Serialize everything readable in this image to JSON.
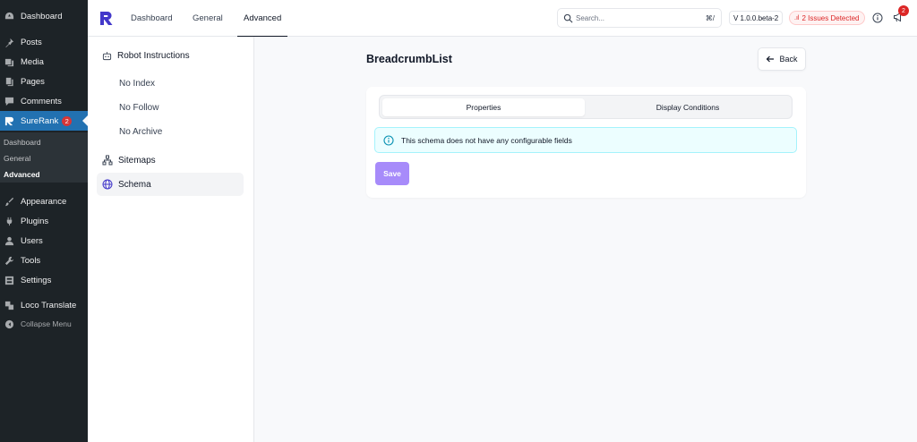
{
  "wp_menu": {
    "dashboard": "Dashboard",
    "posts": "Posts",
    "media": "Media",
    "pages": "Pages",
    "comments": "Comments",
    "surerank": "SureRank",
    "surerank_badge": "2",
    "submenu": [
      "Dashboard",
      "General",
      "Advanced"
    ],
    "appearance": "Appearance",
    "plugins": "Plugins",
    "users": "Users",
    "tools": "Tools",
    "settings": "Settings",
    "loco": "Loco Translate",
    "collapse": "Collapse Menu"
  },
  "topnav": {
    "tabs": [
      "Dashboard",
      "General",
      "Advanced"
    ],
    "active_tab": "Advanced",
    "search_placeholder": "Search...",
    "search_shortcut": "⌘/",
    "version": "V 1.0.0.beta-2",
    "issues": "2 Issues Detected",
    "notifications_count": "2"
  },
  "settings_nav": {
    "robot_group": "Robot Instructions",
    "robot_items": [
      "No Index",
      "No Follow",
      "No Archive"
    ],
    "sitemaps": "Sitemaps",
    "schema": "Schema"
  },
  "main": {
    "title": "BreadcrumbList",
    "back_label": "Back",
    "tabs": [
      "Properties",
      "Display Conditions"
    ],
    "active_tab": "Properties",
    "notice": "This schema does not have any configurable fields",
    "save_label": "Save"
  },
  "colors": {
    "wp_sidebar": "#1d2327",
    "wp_active": "#2271b1",
    "accent": "#a78bfa",
    "danger": "#dc2626",
    "notice_bg": "#ecfeff"
  },
  "icons": {
    "wp": [
      "dashboard-icon",
      "pin-icon",
      "media-icon",
      "pages-icon",
      "comment-icon",
      "surerank-icon",
      "brush-icon",
      "plug-icon",
      "user-icon",
      "wrench-icon",
      "settings-icon",
      "translate-icon",
      "collapse-icon"
    ],
    "top": [
      "logo-icon",
      "search-icon",
      "info-icon",
      "megaphone-icon"
    ],
    "nav": [
      "robot-icon",
      "sitemap-icon",
      "globe-icon"
    ],
    "main": [
      "arrow-left-icon",
      "info-circle-icon"
    ]
  }
}
